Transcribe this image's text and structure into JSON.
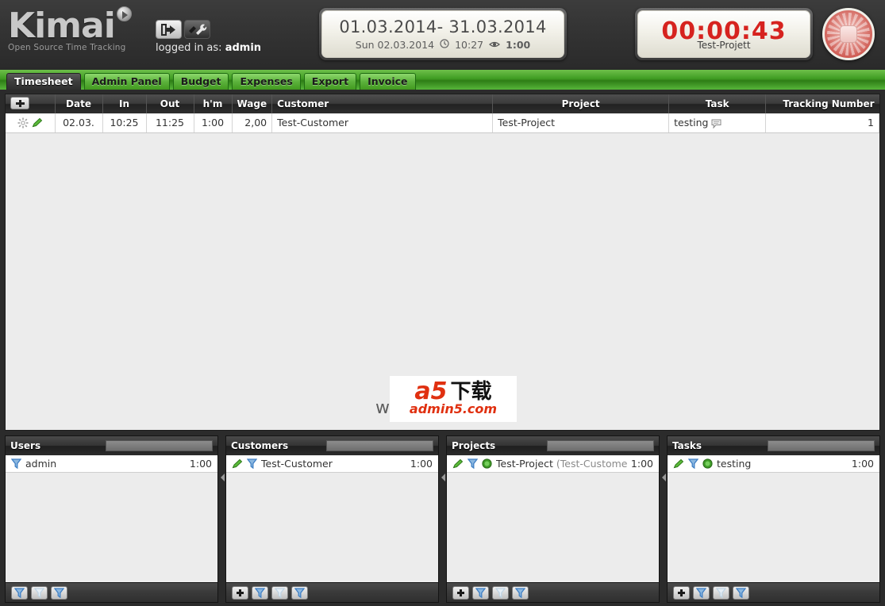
{
  "header": {
    "logo_text": "Kimai",
    "logo_tagline": "Open Source Time Tracking",
    "logout_icon": "logout-icon",
    "settings_icon": "wrench-icon",
    "logged_in_label": "logged in as:",
    "logged_in_user": "admin",
    "date_range": "01.03.2014- 31.03.2014",
    "current_day": "Sun 02.03.2014",
    "clock_icon": "clock-icon",
    "current_time": "10:27",
    "eye_icon": "eye-icon",
    "tracked_total": "1:00",
    "timer_value": "00:00:43",
    "timer_project": "Test-Projett",
    "stop_icon": "stop-recording-icon",
    "timer_color": "#d6231f"
  },
  "tabs": [
    {
      "label": "Timesheet",
      "active": true
    },
    {
      "label": "Admin Panel",
      "active": false
    },
    {
      "label": "Budget",
      "active": false
    },
    {
      "label": "Expenses",
      "active": false
    },
    {
      "label": "Export",
      "active": false
    },
    {
      "label": "Invoice",
      "active": false
    }
  ],
  "timesheet": {
    "add_button_icon": "plus-icon",
    "columns": [
      "",
      "Date",
      "In",
      "Out",
      "h'm",
      "Wage",
      "Customer",
      "Project",
      "Task",
      "Tracking Number"
    ],
    "rows": [
      {
        "action_icons": [
          "sunburst-icon",
          "edit-pencil-icon"
        ],
        "date": "02.03.",
        "in": "10:25",
        "out": "11:25",
        "hm": "1:00",
        "wage": "2,00",
        "customer": "Test-Customer",
        "project": "Test-Project",
        "task": "testing",
        "task_comment_icon": "comment-icon",
        "tracking_number": "1"
      }
    ],
    "hm_highlight_color": "#a5e5a0"
  },
  "watermark": {
    "prefix": "ww",
    "logo_a5": "a5",
    "logo_cn": "下载",
    "url": "admin5.com"
  },
  "panels": [
    {
      "title": "Users",
      "search_value": "",
      "rows": [
        {
          "icons": [
            "filter-icon"
          ],
          "name": "admin",
          "sub": "",
          "time": "1:00"
        }
      ],
      "footer_buttons": [
        "filter-blue-icon",
        "filter-grey-icon",
        "filter-blue-icon"
      ],
      "has_add": false
    },
    {
      "title": "Customers",
      "search_value": "",
      "rows": [
        {
          "icons": [
            "edit-pencil-icon",
            "filter-icon"
          ],
          "name": "Test-Customer",
          "sub": "",
          "time": "1:00"
        }
      ],
      "footer_buttons": [
        "filter-blue-icon",
        "filter-grey-icon",
        "filter-blue-icon"
      ],
      "has_add": true,
      "add_label": "+"
    },
    {
      "title": "Projects",
      "search_value": "",
      "rows": [
        {
          "icons": [
            "edit-pencil-icon",
            "filter-icon",
            "green-ball-icon"
          ],
          "name": "Test-Project",
          "sub": "(Test-Customer)",
          "time": "1:00"
        }
      ],
      "footer_buttons": [
        "filter-blue-icon",
        "filter-grey-icon",
        "filter-blue-icon"
      ],
      "has_add": true,
      "add_label": "+"
    },
    {
      "title": "Tasks",
      "search_value": "",
      "rows": [
        {
          "icons": [
            "edit-pencil-icon",
            "filter-icon",
            "green-ball-icon"
          ],
          "name": "testing",
          "sub": "",
          "time": "1:00"
        }
      ],
      "footer_buttons": [
        "filter-blue-icon",
        "filter-grey-icon",
        "filter-blue-icon"
      ],
      "has_add": true,
      "add_label": "+"
    }
  ]
}
